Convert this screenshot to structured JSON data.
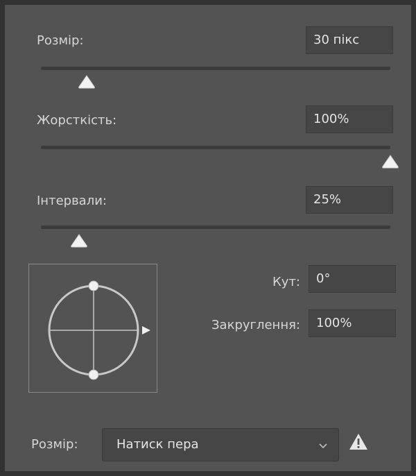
{
  "brush": {
    "size_label": "Розмір:",
    "size_value": "30 пікс",
    "hardness_label": "Жорсткість:",
    "hardness_value": "100%",
    "spacing_label": "Інтервали:",
    "spacing_value": "25%",
    "angle_label": "Кут:",
    "angle_value": "0°",
    "roundness_label": "Закруглення:",
    "roundness_value": "100%"
  },
  "sliders": {
    "size_fraction": 0.13,
    "hardness_fraction": 1.0,
    "spacing_fraction": 0.11
  },
  "control": {
    "label": "Розмір:",
    "selected": "Натиск пера"
  },
  "icons": {
    "dropdown": "chevron-down-icon",
    "warning": "warning-icon",
    "slider_thumb": "triangle-thumb-icon",
    "angle_arrow": "play-arrow-icon"
  },
  "colors": {
    "panel": "#535353",
    "field": "#464646",
    "track": "#3c3c3c",
    "text": "#d6d6d6",
    "thumb": "#f2f2f2"
  }
}
